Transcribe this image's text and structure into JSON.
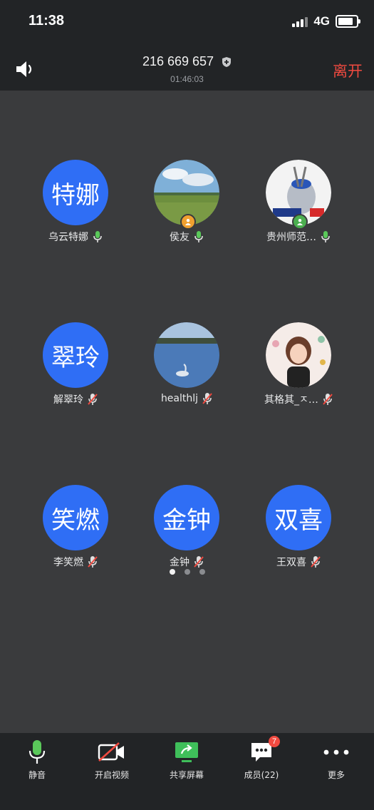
{
  "status": {
    "time": "11:38",
    "network": "4G",
    "battery_level": 0.85
  },
  "header": {
    "meeting_id": "216 669 657",
    "duration": "01:46:03",
    "leave_label": "离开"
  },
  "participants": [
    {
      "avatar_text": "特娜",
      "name": "乌云特娜",
      "mic": "on"
    },
    {
      "avatar_text": "",
      "name": "侯友",
      "mic": "on",
      "host": true
    },
    {
      "avatar_text": "",
      "name": "贵州师范…",
      "mic": "on",
      "host": true
    },
    {
      "avatar_text": "翠玲",
      "name": "解翠玲",
      "mic": "muted"
    },
    {
      "avatar_text": "",
      "name": "healthlj",
      "mic": "muted"
    },
    {
      "avatar_text": "",
      "name": "其格其_ㅈ…",
      "mic": "muted"
    },
    {
      "avatar_text": "笑燃",
      "name": "李笑燃",
      "mic": "muted"
    },
    {
      "avatar_text": "金钟",
      "name": "金钟",
      "mic": "muted"
    },
    {
      "avatar_text": "双喜",
      "name": "王双喜",
      "mic": "muted"
    }
  ],
  "pager": {
    "pages": 3,
    "current": 1
  },
  "toolbar": {
    "mute_label": "静音",
    "video_label": "开启视频",
    "share_label": "共享屏幕",
    "members_label": "成员(22)",
    "chat_badge": "7",
    "more_label": "更多"
  },
  "colors": {
    "accent": "#2f6ef5",
    "leave": "#f04a40",
    "mic_on": "#5ac85a"
  }
}
